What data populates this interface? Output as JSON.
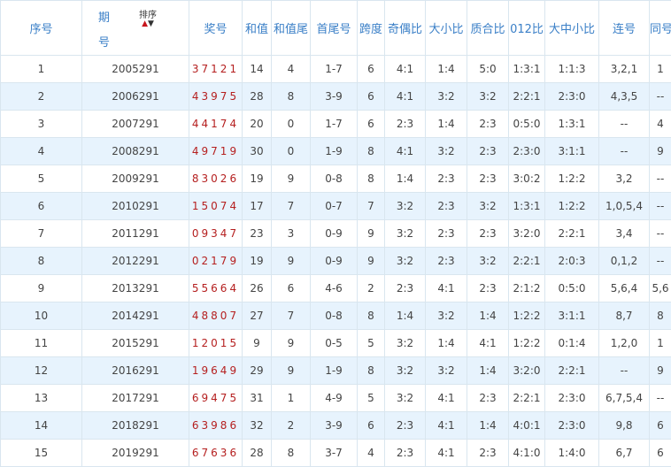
{
  "headers": {
    "seq": "序号",
    "period_top": "期",
    "period_bottom": "号",
    "sort_label": "排序",
    "sort_up_icon": "▲",
    "sort_down_icon": "▼",
    "draw": "奖号",
    "sum": "和值",
    "sum_tail": "和值尾",
    "first_last": "首尾号",
    "span": "跨度",
    "odd_even": "奇偶比",
    "big_small": "大小比",
    "prime_composite": "质合比",
    "mod012": "012比",
    "big_mid_small": "大中小比",
    "consecutive": "连号",
    "same": "同号"
  },
  "rows": [
    {
      "seq": "1",
      "period": "2005291",
      "draw": "37121",
      "sum": "14",
      "sum_tail": "4",
      "first_last": "1-7",
      "span": "6",
      "odd_even": "4:1",
      "big_small": "1:4",
      "prime_composite": "5:0",
      "mod012": "1:3:1",
      "big_mid_small": "1:1:3",
      "consecutive": "3,2,1",
      "same": "1"
    },
    {
      "seq": "2",
      "period": "2006291",
      "draw": "43975",
      "sum": "28",
      "sum_tail": "8",
      "first_last": "3-9",
      "span": "6",
      "odd_even": "4:1",
      "big_small": "3:2",
      "prime_composite": "3:2",
      "mod012": "2:2:1",
      "big_mid_small": "2:3:0",
      "consecutive": "4,3,5",
      "same": "--"
    },
    {
      "seq": "3",
      "period": "2007291",
      "draw": "44174",
      "sum": "20",
      "sum_tail": "0",
      "first_last": "1-7",
      "span": "6",
      "odd_even": "2:3",
      "big_small": "1:4",
      "prime_composite": "2:3",
      "mod012": "0:5:0",
      "big_mid_small": "1:3:1",
      "consecutive": "--",
      "same": "4"
    },
    {
      "seq": "4",
      "period": "2008291",
      "draw": "49719",
      "sum": "30",
      "sum_tail": "0",
      "first_last": "1-9",
      "span": "8",
      "odd_even": "4:1",
      "big_small": "3:2",
      "prime_composite": "2:3",
      "mod012": "2:3:0",
      "big_mid_small": "3:1:1",
      "consecutive": "--",
      "same": "9"
    },
    {
      "seq": "5",
      "period": "2009291",
      "draw": "83026",
      "sum": "19",
      "sum_tail": "9",
      "first_last": "0-8",
      "span": "8",
      "odd_even": "1:4",
      "big_small": "2:3",
      "prime_composite": "2:3",
      "mod012": "3:0:2",
      "big_mid_small": "1:2:2",
      "consecutive": "3,2",
      "same": "--"
    },
    {
      "seq": "6",
      "period": "2010291",
      "draw": "15074",
      "sum": "17",
      "sum_tail": "7",
      "first_last": "0-7",
      "span": "7",
      "odd_even": "3:2",
      "big_small": "2:3",
      "prime_composite": "3:2",
      "mod012": "1:3:1",
      "big_mid_small": "1:2:2",
      "consecutive": "1,0,5,4",
      "same": "--"
    },
    {
      "seq": "7",
      "period": "2011291",
      "draw": "09347",
      "sum": "23",
      "sum_tail": "3",
      "first_last": "0-9",
      "span": "9",
      "odd_even": "3:2",
      "big_small": "2:3",
      "prime_composite": "2:3",
      "mod012": "3:2:0",
      "big_mid_small": "2:2:1",
      "consecutive": "3,4",
      "same": "--"
    },
    {
      "seq": "8",
      "period": "2012291",
      "draw": "02179",
      "sum": "19",
      "sum_tail": "9",
      "first_last": "0-9",
      "span": "9",
      "odd_even": "3:2",
      "big_small": "2:3",
      "prime_composite": "3:2",
      "mod012": "2:2:1",
      "big_mid_small": "2:0:3",
      "consecutive": "0,1,2",
      "same": "--"
    },
    {
      "seq": "9",
      "period": "2013291",
      "draw": "55664",
      "sum": "26",
      "sum_tail": "6",
      "first_last": "4-6",
      "span": "2",
      "odd_even": "2:3",
      "big_small": "4:1",
      "prime_composite": "2:3",
      "mod012": "2:1:2",
      "big_mid_small": "0:5:0",
      "consecutive": "5,6,4",
      "same": "5,6"
    },
    {
      "seq": "10",
      "period": "2014291",
      "draw": "48807",
      "sum": "27",
      "sum_tail": "7",
      "first_last": "0-8",
      "span": "8",
      "odd_even": "1:4",
      "big_small": "3:2",
      "prime_composite": "1:4",
      "mod012": "1:2:2",
      "big_mid_small": "3:1:1",
      "consecutive": "8,7",
      "same": "8"
    },
    {
      "seq": "11",
      "period": "2015291",
      "draw": "12015",
      "sum": "9",
      "sum_tail": "9",
      "first_last": "0-5",
      "span": "5",
      "odd_even": "3:2",
      "big_small": "1:4",
      "prime_composite": "4:1",
      "mod012": "1:2:2",
      "big_mid_small": "0:1:4",
      "consecutive": "1,2,0",
      "same": "1"
    },
    {
      "seq": "12",
      "period": "2016291",
      "draw": "19649",
      "sum": "29",
      "sum_tail": "9",
      "first_last": "1-9",
      "span": "8",
      "odd_even": "3:2",
      "big_small": "3:2",
      "prime_composite": "1:4",
      "mod012": "3:2:0",
      "big_mid_small": "2:2:1",
      "consecutive": "--",
      "same": "9"
    },
    {
      "seq": "13",
      "period": "2017291",
      "draw": "69475",
      "sum": "31",
      "sum_tail": "1",
      "first_last": "4-9",
      "span": "5",
      "odd_even": "3:2",
      "big_small": "4:1",
      "prime_composite": "2:3",
      "mod012": "2:2:1",
      "big_mid_small": "2:3:0",
      "consecutive": "6,7,5,4",
      "same": "--"
    },
    {
      "seq": "14",
      "period": "2018291",
      "draw": "63986",
      "sum": "32",
      "sum_tail": "2",
      "first_last": "3-9",
      "span": "6",
      "odd_even": "2:3",
      "big_small": "4:1",
      "prime_composite": "1:4",
      "mod012": "4:0:1",
      "big_mid_small": "2:3:0",
      "consecutive": "9,8",
      "same": "6"
    },
    {
      "seq": "15",
      "period": "2019291",
      "draw": "67636",
      "sum": "28",
      "sum_tail": "8",
      "first_last": "3-7",
      "span": "4",
      "odd_even": "2:3",
      "big_small": "4:1",
      "prime_composite": "2:3",
      "mod012": "4:1:0",
      "big_mid_small": "1:4:0",
      "consecutive": "6,7",
      "same": "6"
    }
  ]
}
